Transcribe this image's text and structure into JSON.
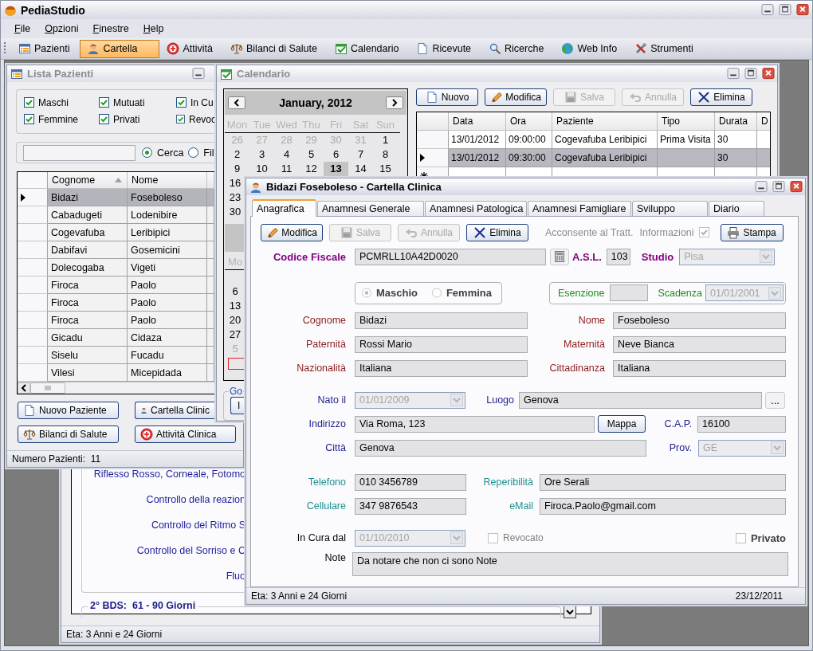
{
  "app": {
    "title": "PediaStudio"
  },
  "menu": [
    "File",
    "Opzioni",
    "Finestre",
    "Help"
  ],
  "toolbar": [
    {
      "label": "Pazienti",
      "selected": false
    },
    {
      "label": "Cartella",
      "selected": true
    },
    {
      "label": "Attività",
      "selected": false
    },
    {
      "label": "Bilanci di Salute",
      "selected": false
    },
    {
      "label": "Calendario",
      "selected": false
    },
    {
      "label": "Ricevute",
      "selected": false
    },
    {
      "label": "Ricerche",
      "selected": false
    },
    {
      "label": "Web Info",
      "selected": false
    },
    {
      "label": "Strumenti",
      "selected": false
    }
  ],
  "background_window": {
    "lines": [
      "Riflesso Rosso, Corneale, Fotomo",
      "Controllo della reazion",
      "Controllo del Ritmo S",
      "Controllo del Sorriso e C",
      "Fluo"
    ],
    "group": "2° BDS:  61 - 90 Giorni",
    "status": "Eta: 3 Anni e 24 Giorni"
  },
  "patients_window": {
    "title": "Lista Pazienti",
    "active": false,
    "filters": [
      {
        "label": "Maschi",
        "checked": true
      },
      {
        "label": "Mutuati",
        "checked": true
      },
      {
        "label": "In Cu",
        "checked": true
      },
      {
        "label": "Femmine",
        "checked": true
      },
      {
        "label": "Privati",
        "checked": true
      },
      {
        "label": "Revoc",
        "checked": true
      }
    ],
    "search_modes": [
      {
        "label": "Cerca",
        "selected": true
      },
      {
        "label": "Fil",
        "selected": false
      }
    ],
    "table": {
      "columns": [
        "Cognome",
        "Nome"
      ],
      "rows": [
        {
          "cells": [
            "Bidazi",
            "Foseboleso"
          ],
          "selected": true
        },
        {
          "cells": [
            "Cabadugeti",
            "Lodenibire"
          ],
          "selected": false
        },
        {
          "cells": [
            "Cogevafuba",
            "Leribipici"
          ],
          "selected": false
        },
        {
          "cells": [
            "Dabifavi",
            "Gosemicini"
          ],
          "selected": false
        },
        {
          "cells": [
            "Dolecogaba",
            "Vigeti"
          ],
          "selected": false
        },
        {
          "cells": [
            "Firoca",
            "Paolo"
          ],
          "selected": false
        },
        {
          "cells": [
            "Firoca",
            "Paolo"
          ],
          "selected": false
        },
        {
          "cells": [
            "Firoca",
            "Paolo"
          ],
          "selected": false
        },
        {
          "cells": [
            "Gicadu",
            "Cidaza"
          ],
          "selected": false
        },
        {
          "cells": [
            "Siselu",
            "Fucadu"
          ],
          "selected": false
        },
        {
          "cells": [
            "Vilesi",
            "Micepidada"
          ],
          "selected": false
        }
      ]
    },
    "buttons": [
      "Nuovo Paziente",
      "Cartella Clinic",
      "Bilanci di Salute",
      "Attività Clinica"
    ],
    "status": "Numero Pazienti:  11"
  },
  "calendar_window": {
    "title": "Calendario",
    "active": false,
    "month": "January, 2012",
    "weekdays": [
      "Mon",
      "Tue",
      "Wed",
      "Thu",
      "Fri",
      "Sat",
      "Sun"
    ],
    "weeks": [
      [
        {
          "day": "26",
          "other_month": true,
          "selected": false
        },
        {
          "day": "27",
          "other_month": true,
          "selected": false
        },
        {
          "day": "28",
          "other_month": true,
          "selected": false
        },
        {
          "day": "29",
          "other_month": true,
          "selected": false
        },
        {
          "day": "30",
          "other_month": true,
          "selected": false
        },
        {
          "day": "31",
          "other_month": true,
          "selected": false
        },
        {
          "day": "1",
          "other_month": false,
          "selected": false
        }
      ],
      [
        {
          "day": "2",
          "other_month": false,
          "selected": false
        },
        {
          "day": "3",
          "other_month": false,
          "selected": false
        },
        {
          "day": "4",
          "other_month": false,
          "selected": false
        },
        {
          "day": "5",
          "other_month": false,
          "selected": false
        },
        {
          "day": "6",
          "other_month": false,
          "selected": false
        },
        {
          "day": "7",
          "other_month": false,
          "selected": false
        },
        {
          "day": "8",
          "other_month": false,
          "selected": false
        }
      ],
      [
        {
          "day": "9",
          "other_month": false,
          "selected": false
        },
        {
          "day": "10",
          "other_month": false,
          "selected": false
        },
        {
          "day": "11",
          "other_month": false,
          "selected": false
        },
        {
          "day": "12",
          "other_month": false,
          "selected": false
        },
        {
          "day": "13",
          "other_month": false,
          "selected": true
        },
        {
          "day": "14",
          "other_month": false,
          "selected": false
        },
        {
          "day": "15",
          "other_month": false,
          "selected": false
        }
      ],
      [
        {
          "day": "16",
          "other_month": false,
          "selected": false
        }
      ],
      [
        {
          "day": "23",
          "other_month": false,
          "selected": false
        }
      ],
      [
        {
          "day": "30",
          "other_month": false,
          "selected": false
        }
      ]
    ],
    "next_month": {
      "weekday": "Mo",
      "days": [
        {
          "day": "6",
          "other_month": false,
          "selected": false
        },
        {
          "day": "13",
          "other_month": false,
          "selected": false
        },
        {
          "day": "20",
          "other_month": false,
          "selected": false
        },
        {
          "day": "27",
          "other_month": false,
          "selected": false
        },
        {
          "day": "5",
          "other_month": true,
          "selected": false
        }
      ]
    },
    "group_label": "Go",
    "group_button": "I",
    "toolbar": [
      {
        "label": "Nuovo",
        "disabled": false
      },
      {
        "label": "Modifica",
        "disabled": false
      },
      {
        "label": "Salva",
        "disabled": true
      },
      {
        "label": "Annulla",
        "disabled": true
      },
      {
        "label": "Elimina",
        "disabled": false
      }
    ],
    "grid": {
      "columns": [
        "Data",
        "Ora",
        "Paziente",
        "Tipo",
        "Durata",
        "D"
      ],
      "rows": [
        {
          "kind": "data",
          "cells": [
            "13/01/2012",
            "09:00:00",
            "Cogevafuba Leribipici",
            "Prima Visita",
            "30"
          ],
          "selected": false
        },
        {
          "kind": "data",
          "cells": [
            "13/01/2012",
            "09:30:00",
            "Cogevafuba Leribipici",
            null,
            "30"
          ],
          "selected": true
        },
        {
          "kind": "new",
          "selected": false
        }
      ]
    }
  },
  "record_window": {
    "title": "Bidazi Foseboleso - Cartella Clinica",
    "active": true,
    "tabs": [
      {
        "label": "Anagrafica",
        "selected": true
      },
      {
        "label": "Anamnesi Generale",
        "selected": false
      },
      {
        "label": "Anamnesi Patologica",
        "selected": false
      },
      {
        "label": "Anamnesi Famigliare",
        "selected": false
      },
      {
        "label": "Sviluppo",
        "selected": false
      },
      {
        "label": "Diario",
        "selected": false
      }
    ],
    "toolbar": [
      {
        "label": "Modifica",
        "disabled": false
      },
      {
        "label": "Salva",
        "disabled": true
      },
      {
        "label": "Annulla",
        "disabled": true
      },
      {
        "label": "Elimina",
        "disabled": false
      }
    ],
    "consent_label": "Acconsente al Tratt.",
    "info": {
      "label": "Informazioni",
      "checked": true
    },
    "print_button": "Stampa",
    "sex": [
      {
        "label": "Maschio",
        "selected": true
      },
      {
        "label": "Femmina",
        "selected": false
      }
    ],
    "fields": {
      "codice_fiscale": {
        "label": "Codice Fiscale",
        "kind": "text",
        "value": "PCMRLL10A42D0020",
        "color": "#800080"
      },
      "asl": {
        "label": "A.S.L.",
        "kind": "text",
        "value": "103",
        "color": "#800080"
      },
      "studio": {
        "label": "Studio",
        "kind": "dropdown",
        "value": "Pisa",
        "disabled": true,
        "color": "#800080"
      },
      "esenzione": {
        "label": "Esenzione",
        "kind": "text",
        "color": "#1f8a1f"
      },
      "scadenza": {
        "label": "Scadenza",
        "kind": "dropdown",
        "value": "01/01/2001",
        "disabled": true,
        "color": "#1f8a1f"
      },
      "cognome": {
        "label": "Cognome",
        "kind": "text",
        "value": "Bidazi",
        "color": "#8b1a1a"
      },
      "nome": {
        "label": "Nome",
        "kind": "text",
        "value": "Foseboleso",
        "color": "#8b1a1a"
      },
      "paternita": {
        "label": "Paternità",
        "kind": "text",
        "value": "Rossi Mario",
        "color": "#8b1a1a"
      },
      "maternita": {
        "label": "Maternità",
        "kind": "text",
        "value": "Neve Bianca",
        "color": "#8b1a1a"
      },
      "nazionalita": {
        "label": "Nazionalità",
        "kind": "text",
        "value": "Italiana",
        "color": "#8b1a1a"
      },
      "cittadinanza": {
        "label": "Cittadinanza",
        "kind": "text",
        "value": "Italiana",
        "color": "#8b1a1a"
      },
      "nato_il": {
        "label": "Nato il",
        "kind": "dropdown",
        "value": "01/01/2009",
        "disabled": true,
        "color": "#1c1c8c"
      },
      "luogo": {
        "label": "Luogo",
        "kind": "text",
        "value": "Genova",
        "color": "#1c1c8c"
      },
      "indirizzo": {
        "label": "Indirizzo",
        "kind": "text",
        "value": "Via Roma, 123",
        "color": "#1c1c8c"
      },
      "cap": {
        "label": "C.A.P.",
        "kind": "text",
        "value": "16100",
        "color": "#1c1c8c"
      },
      "citta": {
        "label": "Città",
        "kind": "text",
        "value": "Genova",
        "color": "#1c1c8c"
      },
      "prov": {
        "label": "Prov.",
        "kind": "dropdown",
        "value": "GE",
        "disabled": true,
        "color": "#1c1c8c"
      },
      "telefono": {
        "label": "Telefono",
        "kind": "text",
        "value": "010 3456789",
        "color": "#1f8f8f"
      },
      "reperibilita": {
        "label": "Reperibilità",
        "kind": "text",
        "value": "Ore Serali",
        "color": "#1f8f8f"
      },
      "cellulare": {
        "label": "Cellulare",
        "kind": "text",
        "value": "347 9876543",
        "color": "#1f8f8f"
      },
      "email": {
        "label": "eMail",
        "kind": "text",
        "value": "Firoca.Paolo@gmail.com",
        "color": "#1f8f8f"
      },
      "in_cura_dal": {
        "label": "In Cura dal",
        "kind": "dropdown",
        "value": "01/10/2010",
        "disabled": true,
        "color": "#000000"
      },
      "note": {
        "label": "Note",
        "kind": "note",
        "value": "Da notare che non ci sono Note",
        "color": "#000000"
      }
    },
    "map_button": "Mappa",
    "place_button": "...",
    "revocato": {
      "label": "Revocato",
      "checked": false,
      "disabled": true
    },
    "privato": {
      "label": "Privato",
      "checked": false
    },
    "status": {
      "age": "Eta: 3 Anni e 24 Giorni",
      "date": "23/12/2011"
    }
  }
}
